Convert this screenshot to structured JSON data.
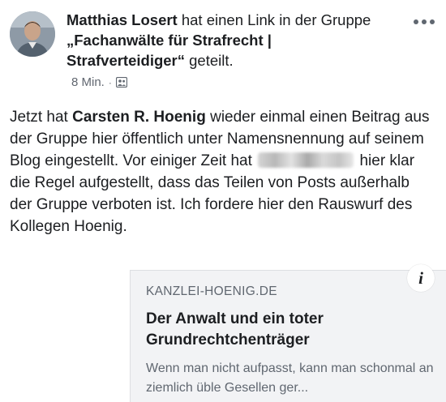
{
  "post": {
    "author": "Matthias Losert",
    "action_text_1": "hat einen Link in der Gruppe",
    "group_open_quote": "„",
    "group_name": "Fachanwälte für Strafrecht | Strafverteidiger",
    "group_close_quote": "“",
    "action_text_2": "geteilt.",
    "timestamp": "8 Min.",
    "separator": "·",
    "audience_icon": "group-audience-icon",
    "body": {
      "part1": "Jetzt hat",
      "mention": "Carsten R. Hoenig",
      "part2": "wieder einmal einen Beitrag aus der Gruppe hier öffentlich unter Namensnennung auf seinem Blog eingestellt. Vor einiger Zeit hat",
      "part3": "hier klar die Regel aufgestellt, dass das Teilen von Posts außerhalb der Gruppe verboten ist. Ich fordere hier den Rauswurf des Kollegen Hoenig."
    }
  },
  "link_preview": {
    "domain": "KANZLEI-HOENIG.DE",
    "title": "Der Anwalt und ein toter Grundrechtchenträger",
    "description": "Wenn man nicht aufpasst, kann man schonmal an ziemlich üble Gesellen ger..."
  },
  "icons": {
    "more": "more-options-icon",
    "info": "info-icon",
    "info_glyph": "i"
  },
  "colors": {
    "text": "#1c1e21",
    "secondary": "#616770",
    "card_bg": "#f2f3f5"
  }
}
